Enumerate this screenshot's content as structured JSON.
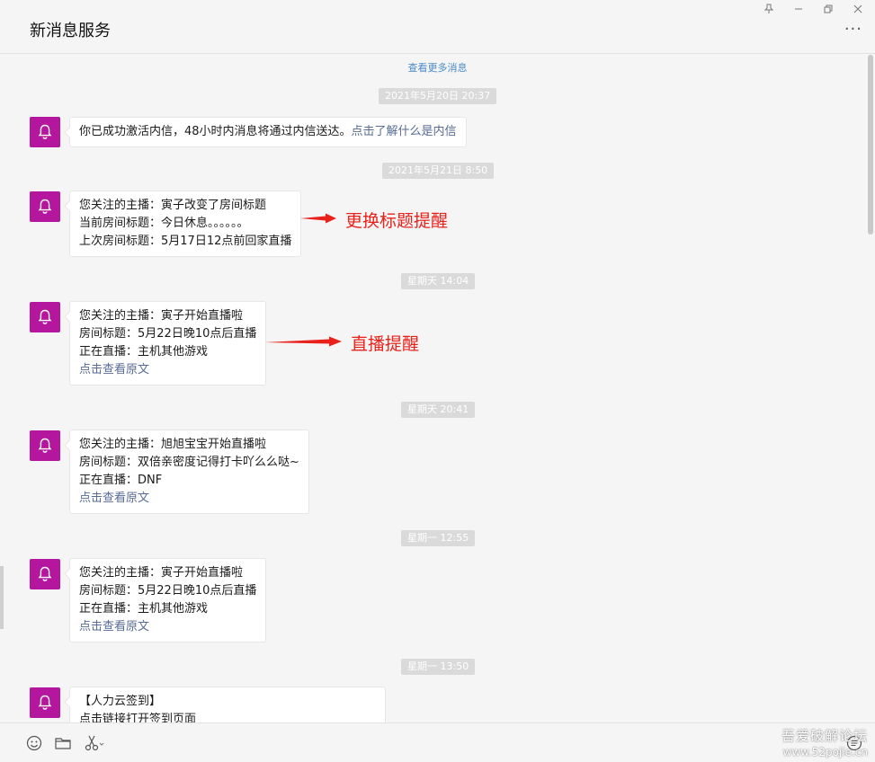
{
  "window": {
    "title": "新消息服务",
    "controls": {
      "pin": "pin-icon",
      "minimize": "minimize-icon",
      "restore": "restore-icon",
      "close": "close-icon"
    },
    "more": "···"
  },
  "chat": {
    "load_more": "查看更多消息",
    "accent_color": "#b4169e",
    "link_color": "#576b95",
    "items": [
      {
        "timestamp": "2021年5月20日 20:37"
      },
      {
        "message": {
          "text": "你已成功激活内信，48小时内消息将通过内信送达。",
          "link": "点击了解什么是内信"
        }
      },
      {
        "timestamp": "2021年5月21日 8:50"
      },
      {
        "message": {
          "lines": [
            "您关注的主播：寅子改变了房间标题",
            "当前房间标题：今日休息。。。。。。",
            "上次房间标题：5月17日12点前回家直播"
          ]
        }
      },
      {
        "timestamp": "星期天 14:04"
      },
      {
        "message": {
          "lines": [
            "您关注的主播：寅子开始直播啦",
            "房间标题：5月22日晚10点后直播",
            "正在直播：主机其他游戏"
          ],
          "link": "点击查看原文"
        }
      },
      {
        "timestamp": "星期天 20:41"
      },
      {
        "message": {
          "lines": [
            "您关注的主播：旭旭宝宝开始直播啦",
            "房间标题：双倍亲密度记得打卡吖么么哒~",
            "正在直播：DNF"
          ],
          "link": "点击查看原文"
        }
      },
      {
        "timestamp": "星期一 12:55"
      },
      {
        "message": {
          "lines": [
            "您关注的主播：寅子开始直播啦",
            "房间标题：5月22日晚10点后直播",
            "正在直播：主机其他游戏"
          ],
          "link": "点击查看原文"
        }
      },
      {
        "timestamp": "星期一 13:50"
      },
      {
        "message": {
          "lines": [
            "【人力云签到】",
            "点击链接打开签到页面"
          ]
        }
      }
    ]
  },
  "annotations": {
    "title_change": "更换标题提醒",
    "live": "直播提醒",
    "color": "#e8221b"
  },
  "toolbar": {
    "emoji": "emoji-icon",
    "folder": "folder-icon",
    "scissors": "scissors-icon",
    "history": "chat-history-icon"
  },
  "watermark": {
    "line1": "吾爱破解论坛",
    "line2": "www.52pojie.cn"
  }
}
